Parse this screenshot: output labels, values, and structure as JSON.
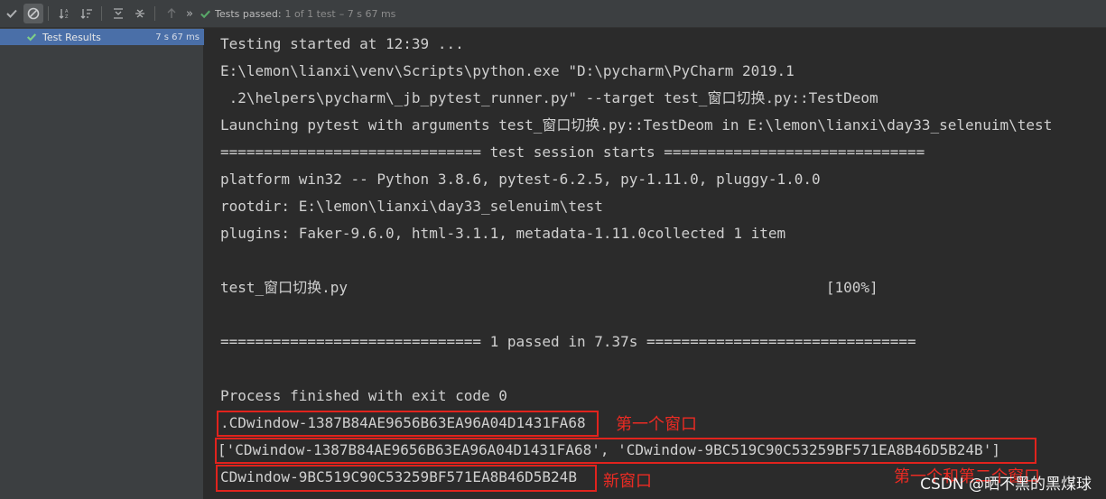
{
  "toolbar": {
    "status_label": "Tests passed:",
    "status_count": "1 of 1 test",
    "status_time": "– 7 s 67 ms"
  },
  "tree": {
    "root_label": "Test Results",
    "root_time": "7 s 67 ms"
  },
  "console": {
    "lines": [
      "Testing started at 12:39 ...",
      "E:\\lemon\\lianxi\\venv\\Scripts\\python.exe \"D:\\pycharm\\PyCharm 2019.1",
      " .2\\helpers\\pycharm\\_jb_pytest_runner.py\" --target test_窗口切换.py::TestDeom",
      "Launching pytest with arguments test_窗口切换.py::TestDeom in E:\\lemon\\lianxi\\day33_selenuim\\test",
      "============================== test session starts ==============================",
      "platform win32 -- Python 3.8.6, pytest-6.2.5, py-1.11.0, pluggy-1.0.0",
      "rootdir: E:\\lemon\\lianxi\\day33_selenuim\\test",
      "plugins: Faker-9.6.0, html-3.1.1, metadata-1.11.0collected 1 item",
      "",
      "test_窗口切换.py                                                       [100%]",
      "",
      "============================== 1 passed in 7.37s ===============================",
      "",
      "Process finished with exit code 0",
      ".CDwindow-1387B84AE9656B63EA96A04D1431FA68",
      "['CDwindow-1387B84AE9656B63EA96A04D1431FA68', 'CDwindow-9BC519C90C53259BF571EA8B46D5B24B']",
      "CDwindow-9BC519C90C53259BF571EA8B46D5B24B"
    ]
  },
  "annotations": {
    "first_window": "第一个窗口",
    "both_windows": "第一个和第二个窗口",
    "new_window": "新窗口"
  },
  "watermark": "CSDN @晒不黑的黑煤球",
  "colors": {
    "accent_selection": "#4a6fa8",
    "pass_green": "#59a869",
    "annotation_red": "#e1231d"
  }
}
